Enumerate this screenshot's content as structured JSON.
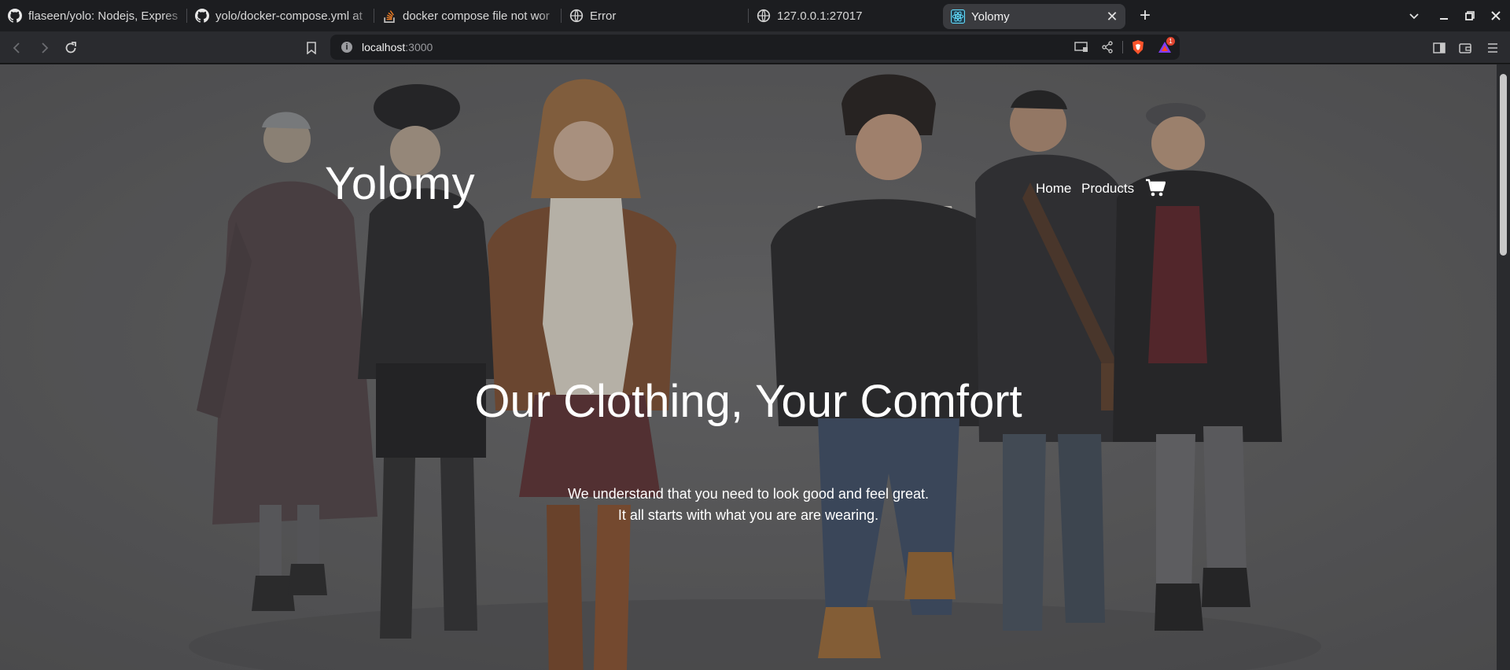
{
  "browser": {
    "tabs": [
      {
        "title": "flaseen/yolo: Nodejs, Expres",
        "icon": "github-icon",
        "active": false
      },
      {
        "title": "yolo/docker-compose.yml at",
        "icon": "github-icon",
        "active": false
      },
      {
        "title": "docker compose file not wor",
        "icon": "stackoverflow-icon",
        "active": false
      },
      {
        "title": "Error",
        "icon": "globe-icon",
        "active": false
      },
      {
        "title": "127.0.0.1:27017",
        "icon": "globe-icon",
        "active": false
      },
      {
        "title": "Yolomy",
        "icon": "react-icon",
        "active": true
      }
    ],
    "close_tab_symbol": "✕",
    "new_tab_symbol": "+",
    "window_controls": {
      "dropdown": "⌄",
      "minimize": "–",
      "restore": "❐",
      "close": "✕"
    },
    "address": {
      "host": "localhost",
      "port": ":3000"
    },
    "brave_rewards_count": "1",
    "accent_color": "#3a3b3f"
  },
  "page": {
    "brand": "Yolomy",
    "nav": {
      "home": "Home",
      "products": "Products"
    },
    "cart_icon": "shopping-cart-icon",
    "headline": "Our Clothing, Your Comfort",
    "sub_line_1": "We understand that you need to look good and feel great.",
    "sub_line_2": "It all starts with what you are are wearing."
  }
}
